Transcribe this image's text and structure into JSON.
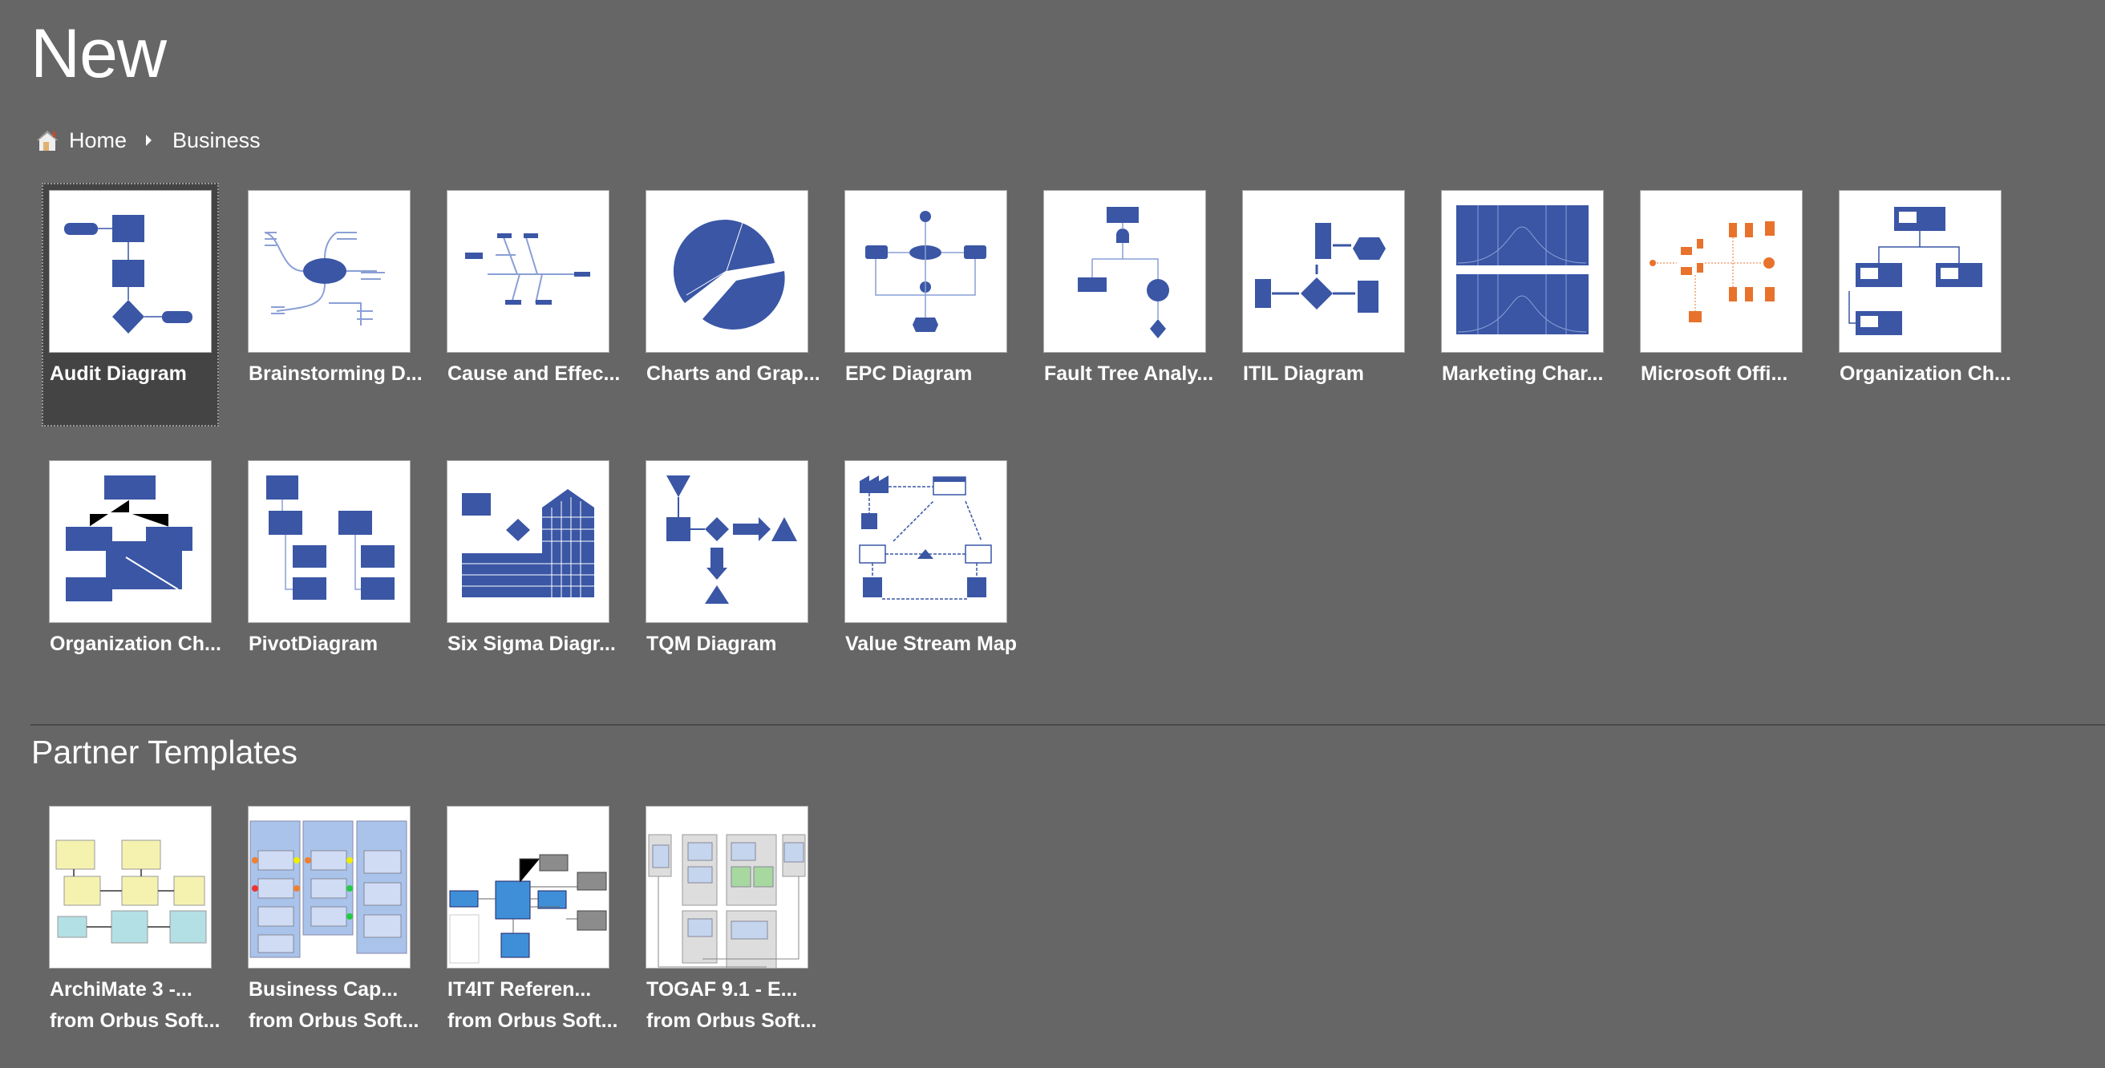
{
  "page_title": "New",
  "breadcrumb": {
    "home": "Home",
    "current": "Business",
    "home_icon": "house-icon"
  },
  "colors": {
    "background": "#666666",
    "selected": "#444444",
    "diagram_blue": "#3a56a5",
    "accent_orange": "#e8722c"
  },
  "templates": [
    {
      "label": "Audit Diagram",
      "icon": "audit",
      "selected": true
    },
    {
      "label": "Brainstorming D...",
      "icon": "brainstorm"
    },
    {
      "label": "Cause and Effec...",
      "icon": "fishbone"
    },
    {
      "label": "Charts and Grap...",
      "icon": "pie"
    },
    {
      "label": "EPC Diagram",
      "icon": "epc"
    },
    {
      "label": "Fault Tree Analy...",
      "icon": "faulttree"
    },
    {
      "label": "ITIL Diagram",
      "icon": "itil"
    },
    {
      "label": "Marketing Char...",
      "icon": "marketing"
    },
    {
      "label": "Microsoft Offi...",
      "icon": "msoffice"
    },
    {
      "label": "Organization Ch...",
      "icon": "org"
    },
    {
      "label": "Organization Ch...",
      "icon": "orgwizard"
    },
    {
      "label": "PivotDiagram",
      "icon": "pivot"
    },
    {
      "label": "Six Sigma Diagr...",
      "icon": "sixsigma"
    },
    {
      "label": "TQM Diagram",
      "icon": "tqm"
    },
    {
      "label": "Value Stream Map",
      "icon": "vsm"
    }
  ],
  "partner_section": {
    "title": "Partner Templates"
  },
  "partner_templates": [
    {
      "label": "ArchiMate 3 -...",
      "publisher": "from Orbus Soft...",
      "icon": "archimate"
    },
    {
      "label": "Business Cap...",
      "publisher": "from Orbus Soft...",
      "icon": "buscap"
    },
    {
      "label": "IT4IT Referen...",
      "publisher": "from Orbus Soft...",
      "icon": "it4it"
    },
    {
      "label": "TOGAF 9.1 - E...",
      "publisher": "from Orbus Soft...",
      "icon": "togaf"
    }
  ]
}
